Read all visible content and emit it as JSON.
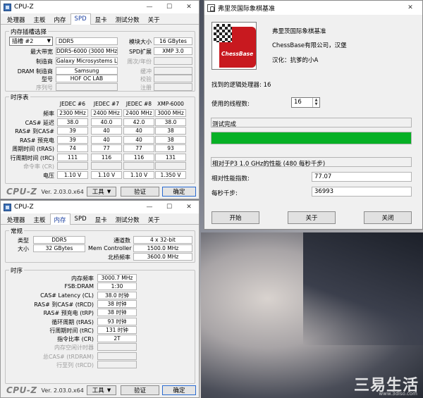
{
  "background": {
    "watermark": "三易生活",
    "watermark_sub": "www.3dlso.com"
  },
  "cpuz_common": {
    "app_title": "CPU-Z",
    "tabs": [
      "处理器",
      "主板",
      "内存",
      "SPD",
      "显卡",
      "测试分数",
      "关于"
    ],
    "brand": "CPU-Z",
    "version": "Ver. 2.03.0.x64",
    "tools_label": "工具",
    "validate_label": "验证",
    "ok_label": "确定"
  },
  "spd": {
    "active_tab": "SPD",
    "slot_group_title": "内存插槽选择",
    "slot_select": "插槽 #2",
    "module_type": "DDR5",
    "module_size_label": "模块大小",
    "module_size": "16 GBytes",
    "max_bandwidth_label": "最大带宽",
    "max_bandwidth": "DDR5-6000 (3000 MHz)",
    "spd_ext_label": "SPD扩展",
    "spd_ext": "XMP 3.0",
    "manufacturer_label": "制造商",
    "manufacturer": "Galaxy Microsystems Ltd.",
    "week_year_label": "周次/年份",
    "dram_mfr_label": "DRAM 制造商",
    "dram_mfr": "Samsung",
    "buffer_label": "缓冲",
    "part_label": "型号",
    "part_number": "HOF OC LAB",
    "check_label": "校验",
    "serial_label": "序列号",
    "registered_label": "注册",
    "timing_group_title": "时序表",
    "columns": [
      "JEDEC #6",
      "JEDEC #7",
      "JEDEC #8",
      "XMP-6000"
    ],
    "rows": [
      {
        "label": "频率",
        "values": [
          "2300 MHz",
          "2400 MHz",
          "2400 MHz",
          "3000 MHz"
        ],
        "dim": false
      },
      {
        "label": "CAS# 延迟",
        "values": [
          "38.0",
          "40.0",
          "42.0",
          "38.0"
        ],
        "dim": false
      },
      {
        "label": "RAS# 到CAS#",
        "values": [
          "39",
          "40",
          "40",
          "38"
        ],
        "dim": false
      },
      {
        "label": "RAS# 预充电",
        "values": [
          "39",
          "40",
          "40",
          "38"
        ],
        "dim": false
      },
      {
        "label": "周期时间 (tRAS)",
        "values": [
          "74",
          "77",
          "77",
          "93"
        ],
        "dim": false
      },
      {
        "label": "行周期时间 (tRC)",
        "values": [
          "111",
          "116",
          "116",
          "131"
        ],
        "dim": false
      },
      {
        "label": "命令率 (CR)",
        "values": [
          "",
          "",
          "",
          ""
        ],
        "dim": true
      },
      {
        "label": "电压",
        "values": [
          "1.10 V",
          "1.10 V",
          "1.10 V",
          "1.350 V"
        ],
        "dim": false
      }
    ]
  },
  "memory": {
    "active_tab": "内存",
    "general_title": "常规",
    "type_label": "类型",
    "type": "DDR5",
    "channels_label": "通道数",
    "channels": "4 x 32-bit",
    "size_label": "大小",
    "size": "32 GBytes",
    "mem_controller_label": "Mem Controller",
    "mem_controller": "1500.0 MHz",
    "northbridge_label": "北桥频率",
    "northbridge": "3600.0 MHz",
    "timings_title": "时序",
    "timings": [
      {
        "label": "内存频率",
        "value": "3000.7 MHz",
        "dim": false
      },
      {
        "label": "FSB:DRAM",
        "value": "1:30",
        "dim": false
      },
      {
        "label": "CAS# Latency (CL)",
        "value": "38.0 时钟",
        "dim": false
      },
      {
        "label": "RAS# 到CAS# (tRCD)",
        "value": "38 时钟",
        "dim": false
      },
      {
        "label": "RAS# 预充电 (tRP)",
        "value": "38 时钟",
        "dim": false
      },
      {
        "label": "循环周期 (tRAS)",
        "value": "93 时钟",
        "dim": false
      },
      {
        "label": "行周期时间 (tRC)",
        "value": "131 时钟",
        "dim": false
      },
      {
        "label": "指令比率 (CR)",
        "value": "2T",
        "dim": false
      },
      {
        "label": "内存空闲计时器",
        "value": "",
        "dim": true
      },
      {
        "label": "总CAS# (tRDRAM)",
        "value": "",
        "dim": true
      },
      {
        "label": "行至列 (tRCD)",
        "value": "",
        "dim": true
      }
    ]
  },
  "chess": {
    "title": "弗里茨国际象棋基准",
    "logo_text": "ChessBase",
    "product": "弗里茨国际象棋基准",
    "company": "ChessBase有限公司，汉堡",
    "localizer": "汉化：抗爹的小A",
    "found_processors": "找到的逻辑处理器: 16",
    "threads_label": "使用的线程数:",
    "threads_value": "16",
    "status": "测试完成",
    "progress_percent": 100,
    "progress_color": "#06b025",
    "relative_line": "相对于P3 1.0 GHz的性能 (480 每秒千步)",
    "relative_index_label": "相对性能指数:",
    "relative_index": "77.07",
    "kilo_nodes_label": "每秒千步:",
    "kilo_nodes": "36993",
    "start_label": "开始",
    "about_label": "关于",
    "close_label": "关闭"
  }
}
